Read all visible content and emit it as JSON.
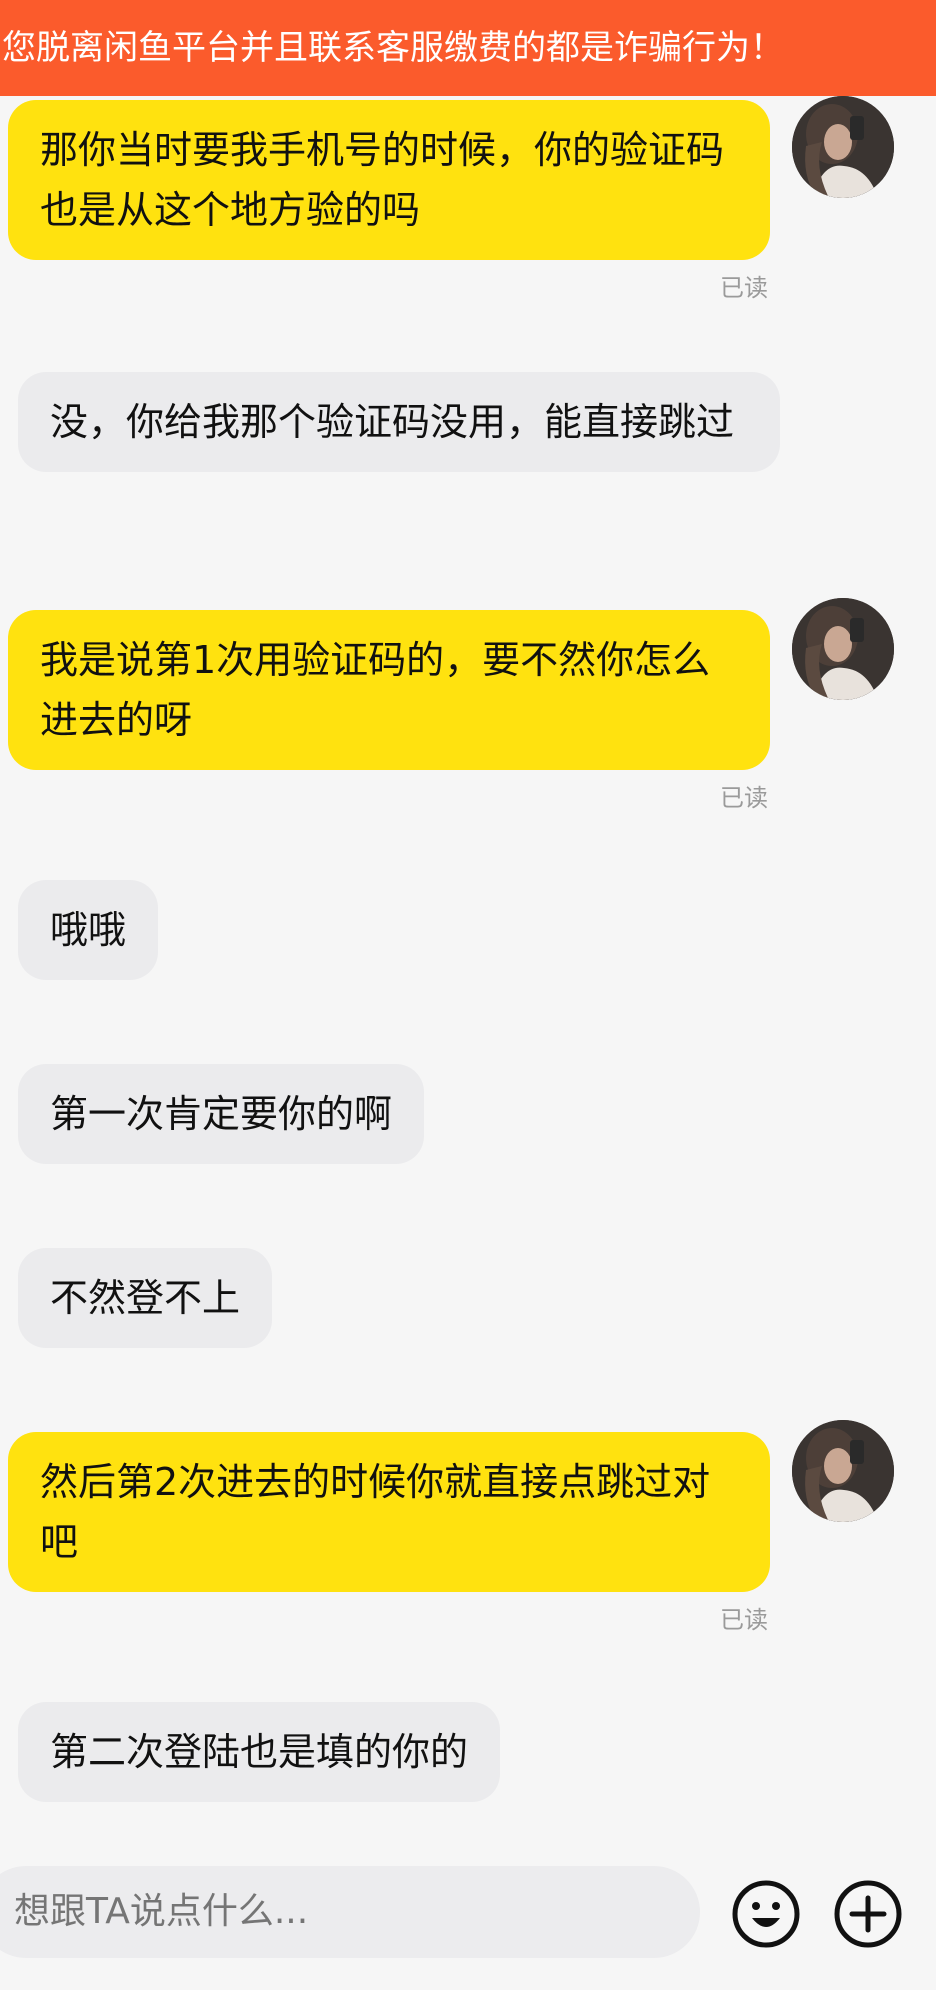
{
  "banner": {
    "text": "您脱离闲鱼平台并且联系客服缴费的都是诈骗行为！"
  },
  "messages": [
    {
      "side": "me",
      "text": "那你当时要我手机号的时候，你的验证码也是从这个地方验的吗",
      "status": "已读"
    },
    {
      "side": "them",
      "text": "没，你给我那个验证码没用，能直接跳过"
    },
    {
      "side": "me",
      "text": "我是说第1次用验证码的，要不然你怎么进去的呀",
      "status": "已读"
    },
    {
      "side": "them",
      "text": "哦哦"
    },
    {
      "side": "them",
      "text": "第一次肯定要你的啊"
    },
    {
      "side": "them",
      "text": "不然登不上"
    },
    {
      "side": "me",
      "text": "然后第2次进去的时候你就直接点跳过对吧",
      "status": "已读"
    },
    {
      "side": "them",
      "text": "第二次登陆也是填的你的"
    }
  ],
  "composer": {
    "placeholder": "想跟TA说点什么...",
    "emoji_icon": "smiley-icon",
    "plus_icon": "plus-circle-icon"
  },
  "colors": {
    "banner": "#fb5b2c",
    "my_bubble": "#ffe20f",
    "their_bubble": "#ebebed",
    "background": "#f6f6f6"
  }
}
